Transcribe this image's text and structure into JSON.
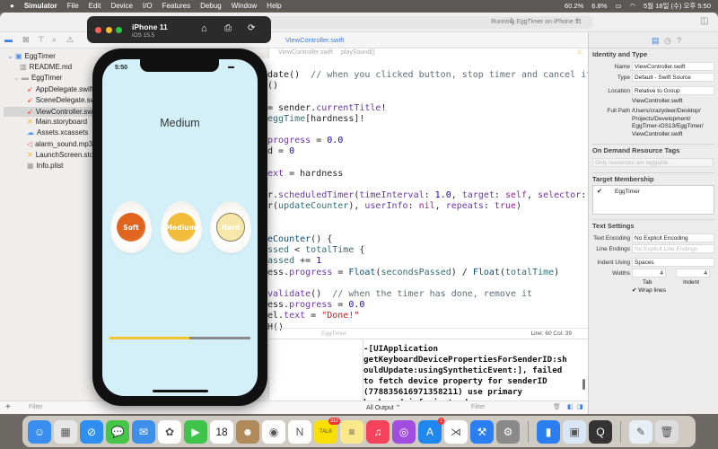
{
  "menubar": {
    "app": "Simulator",
    "items": [
      "File",
      "Edit",
      "Device",
      "I/O",
      "Features",
      "Debug",
      "Window",
      "Help"
    ],
    "status": {
      "cpu": "60.2%",
      "mem": "6.8%",
      "datetime": "5월 18일 (수) 오후 5:50"
    }
  },
  "xcode": {
    "run_status": "Running EggTimer on iPhone 11",
    "warning_count": "1",
    "tab": "ViewController.swift",
    "jump_bar": {
      "file": "ViewController.swift",
      "method": "playSound()"
    },
    "navigator": [
      {
        "label": "EggTimer",
        "icon": "project-icon"
      },
      {
        "label": "README.md",
        "icon": "doc-icon"
      },
      {
        "label": "EggTimer",
        "icon": "folder-icon"
      },
      {
        "label": "AppDelegate.swift",
        "icon": "swift-icon"
      },
      {
        "label": "SceneDelegate.swift",
        "icon": "swift-icon"
      },
      {
        "label": "ViewController.swift",
        "icon": "swift-icon",
        "selected": true
      },
      {
        "label": "Main.storyboard",
        "icon": "storyboard-icon"
      },
      {
        "label": "Assets.xcassets",
        "icon": "assets-icon"
      },
      {
        "label": "alarm_sound.mp3",
        "icon": "audio-icon"
      },
      {
        "label": "LaunchScreen.storyboard",
        "icon": "storyboard-icon"
      },
      {
        "label": "Info.plist",
        "icon": "plist-icon"
      }
    ],
    "code": [
      {
        "line": 0,
        "t": [
          [
            "date()  ",
            ""
          ],
          [
            "// when you clicked button, stop timer and cancel it",
            "cm"
          ]
        ]
      },
      {
        "line": 1,
        "t": [
          [
            "()",
            ""
          ]
        ]
      },
      {
        "line": 3,
        "t": [
          [
            "= sender.",
            ""
          ],
          [
            "currentTitle",
            "pr"
          ],
          [
            "!",
            ""
          ]
        ]
      },
      {
        "line": 4,
        "t": [
          [
            "eggTime",
            "fn"
          ],
          [
            "[hardness]!",
            ""
          ]
        ]
      },
      {
        "line": 6,
        "t": [
          [
            "progress",
            "pr"
          ],
          [
            " = ",
            ""
          ],
          [
            "0.0",
            "num"
          ]
        ]
      },
      {
        "line": 7,
        "t": [
          [
            "d = ",
            ""
          ],
          [
            "0",
            "num"
          ]
        ]
      },
      {
        "line": 9,
        "t": [
          [
            "ext",
            "pr"
          ],
          [
            " = hardness",
            ""
          ]
        ]
      },
      {
        "line": 11,
        "t": [
          [
            "r.",
            ""
          ],
          [
            "scheduledTimer",
            "pr"
          ],
          [
            "(",
            ""
          ],
          [
            "timeInterval",
            "pr"
          ],
          [
            ": ",
            ""
          ],
          [
            "1.0",
            "num"
          ],
          [
            ", ",
            ""
          ],
          [
            "target",
            "pr"
          ],
          [
            ": ",
            ""
          ],
          [
            "self",
            "kw"
          ],
          [
            ", ",
            ""
          ],
          [
            "selector",
            "pr"
          ],
          [
            ":",
            ""
          ]
        ]
      },
      {
        "line": 12,
        "t": [
          [
            "r(",
            ""
          ],
          [
            "updateCounter",
            "fn"
          ],
          [
            "), ",
            ""
          ],
          [
            "userInfo",
            "pr"
          ],
          [
            ": ",
            ""
          ],
          [
            "nil",
            "kw"
          ],
          [
            ", ",
            ""
          ],
          [
            "repeats",
            "pr"
          ],
          [
            ": ",
            ""
          ],
          [
            "true",
            "kw"
          ],
          [
            ")",
            ""
          ]
        ]
      },
      {
        "line": 15,
        "t": [
          [
            "eCounter",
            "ty"
          ],
          [
            "() {",
            ""
          ]
        ]
      },
      {
        "line": 16,
        "t": [
          [
            "ssed",
            "fn"
          ],
          [
            " < ",
            ""
          ],
          [
            "totalTime",
            "fn"
          ],
          [
            " {",
            ""
          ]
        ]
      },
      {
        "line": 17,
        "t": [
          [
            "assed",
            "fn"
          ],
          [
            " += ",
            ""
          ],
          [
            "1",
            "num"
          ]
        ]
      },
      {
        "line": 18,
        "t": [
          [
            "ess.",
            ""
          ],
          [
            "progress",
            "pr"
          ],
          [
            " = ",
            ""
          ],
          [
            "Float",
            "ty"
          ],
          [
            "(",
            ""
          ],
          [
            "secondsPassed",
            "fn"
          ],
          [
            ") / ",
            ""
          ],
          [
            "Float",
            "ty"
          ],
          [
            "(",
            ""
          ],
          [
            "totalTime",
            "fn"
          ],
          [
            ")",
            ""
          ]
        ]
      },
      {
        "line": 20,
        "t": [
          [
            "validate",
            "pr"
          ],
          [
            "()  ",
            ""
          ],
          [
            "// when the timer has done, remove it",
            "cm"
          ]
        ]
      },
      {
        "line": 21,
        "t": [
          [
            "ess.",
            ""
          ],
          [
            "progress",
            "pr"
          ],
          [
            " = ",
            ""
          ],
          [
            "0.0",
            "num"
          ]
        ]
      },
      {
        "line": 22,
        "t": [
          [
            "el.",
            ""
          ],
          [
            "text",
            "pr"
          ],
          [
            " = ",
            ""
          ],
          [
            "\"Done!\"",
            "str"
          ]
        ]
      },
      {
        "line": 23,
        "t": [
          [
            "H()",
            ""
          ]
        ]
      }
    ],
    "editor_status": {
      "position": "Line: 60  Col: 39",
      "scheme": "EggTimer"
    },
    "console": "-[UIApplication\ngetKeyboardDevicePropertiesForSenderID:sh\nouldUpdate:usingSyntheticEvent:], failed\nto fetch device property for senderID\n(778835616971358211) use primary\nkeyboard info instead.",
    "bottom": {
      "filter": "Filter",
      "output": "All Output ⌃",
      "console_filter": "Filter"
    },
    "inspector": {
      "identity_title": "Identity and Type",
      "name_label": "Name",
      "name": "ViewController.swift",
      "type_label": "Type",
      "type": "Default - Swift Source",
      "location_label": "Location",
      "location": "Relative to Group",
      "location_file": "ViewController.swift",
      "fullpath_label": "Full Path",
      "fullpath": "/Users/crazydeer/Desktop/\nProjects/Development/\nEggTimer-iOS13/EggTimer/\nViewController.swift",
      "odr_title": "On Demand Resource Tags",
      "odr_placeholder": "Only resources are taggable",
      "target_title": "Target Membership",
      "target": "EggTimer",
      "text_title": "Text Settings",
      "encoding_label": "Text Encoding",
      "encoding": "No Explicit Encoding",
      "endings_label": "Line Endings",
      "endings": "No Explicit Line Endings",
      "indent_label": "Indent Using",
      "indent": "Spaces",
      "widths_label": "Widths",
      "tab_width": "4",
      "indent_width": "4",
      "tab_label": "Tab",
      "indent_sub_label": "Indent",
      "wrap": "Wrap lines"
    }
  },
  "simulator": {
    "device": "iPhone 11",
    "os": "iOS 15.5",
    "time": "5:50",
    "title": "Medium",
    "eggs": [
      {
        "label": "Soft",
        "color": "#e0641e"
      },
      {
        "label": "Medium",
        "color": "#f2bb3a"
      },
      {
        "label": "Hard",
        "color": "#f6e7a8"
      }
    ],
    "progress": 0.57,
    "progress_color": "#f4c430",
    "track_color": "#8a8a8e"
  },
  "dock": [
    {
      "name": "finder",
      "bg": "#3a8ef0",
      "g": "☺"
    },
    {
      "name": "launchpad",
      "bg": "#e7e7e7",
      "g": "▦"
    },
    {
      "name": "safari",
      "bg": "#2e8ff0",
      "g": "⊘"
    },
    {
      "name": "messages",
      "bg": "#45c649",
      "g": "💬"
    },
    {
      "name": "mail",
      "bg": "#3d8fe9",
      "g": "✉"
    },
    {
      "name": "photos",
      "bg": "#fff",
      "g": "✿"
    },
    {
      "name": "facetime",
      "bg": "#3ec44c",
      "g": "▶"
    },
    {
      "name": "calendar",
      "bg": "#fff",
      "g": "18",
      "label": "18"
    },
    {
      "name": "contacts",
      "bg": "#b08a5a",
      "g": "☻"
    },
    {
      "name": "chrome",
      "bg": "#fff",
      "g": "◉"
    },
    {
      "name": "onenote",
      "bg": "#fff",
      "g": "N"
    },
    {
      "name": "kakaotalk",
      "bg": "#f9e000",
      "g": "TALK",
      "badge": "312"
    },
    {
      "name": "notes",
      "bg": "#fbe88a",
      "g": "≡"
    },
    {
      "name": "music",
      "bg": "#f4435b",
      "g": "♫"
    },
    {
      "name": "podcasts",
      "bg": "#a14ee0",
      "g": "◎"
    },
    {
      "name": "app-store",
      "bg": "#1e88f0",
      "g": "A",
      "badge": "1"
    },
    {
      "name": "vscode",
      "bg": "#fff",
      "g": "⋊"
    },
    {
      "name": "xcode",
      "bg": "#2a7ef2",
      "g": "⚒"
    },
    {
      "name": "system-preferences",
      "bg": "#8a8a8a",
      "g": "⚙"
    },
    {
      "sep": true
    },
    {
      "name": "simulator",
      "bg": "#2a7ef2",
      "g": "▮"
    },
    {
      "name": "preview",
      "bg": "#d8e6f6",
      "g": "▣"
    },
    {
      "name": "quicktime",
      "bg": "#333",
      "g": "Q"
    },
    {
      "sep": true
    },
    {
      "name": "downloads",
      "bg": "#e8eef6",
      "g": "✎"
    },
    {
      "name": "trash",
      "bg": "#ddd",
      "g": "🗑"
    }
  ]
}
